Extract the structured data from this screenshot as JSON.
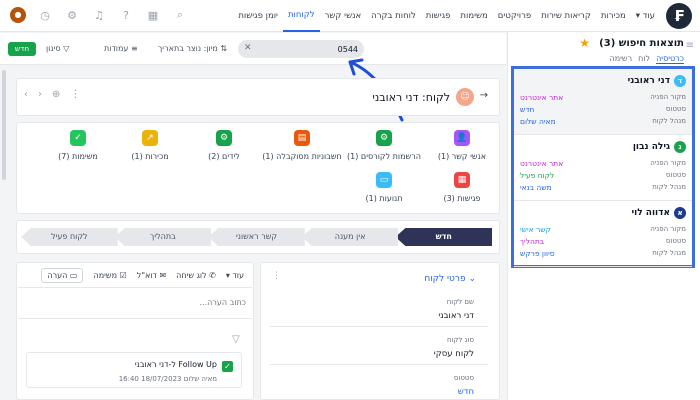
{
  "topbar": {
    "logo": "₣",
    "nav": [
      "יומן פגישות",
      "לקוחות",
      "אנשי קשר",
      "לוחות בקרה",
      "פגישות",
      "משימות",
      "פרויקטים",
      "קריאות שירות",
      "מכירות",
      "עוד"
    ],
    "active_index": 1
  },
  "toolbar": {
    "new_label": "חדש",
    "filter_label": "סינון",
    "columns_label": "עמודות",
    "sort_label": "מיון: נוצר בתאריך",
    "search_value": "0544"
  },
  "results": {
    "title": "תוצאות חיפוש (3)",
    "tabs": [
      "כרטיסיה",
      "לוח",
      "רשימה"
    ],
    "active_tab": 0,
    "cards": [
      {
        "name": "דני ראובני",
        "badge": "ד",
        "color": "#38bdf8",
        "rows": [
          {
            "label": "מקור הפניה",
            "value": "אתר אינטרנט",
            "color": "#c026d3"
          },
          {
            "label": "סטטוס",
            "value": "חדש",
            "color": "#2563eb"
          },
          {
            "label": "מנהל לקוח",
            "value": "מאיה שלום",
            "color": "#2563eb"
          }
        ]
      },
      {
        "name": "גילה נבון",
        "badge": "ג",
        "color": "#16a34a",
        "rows": [
          {
            "label": "מקור הפניה",
            "value": "אתר אינטרנט",
            "color": "#c026d3"
          },
          {
            "label": "סטטוס",
            "value": "לקוח פעיל",
            "color": "#16a34a"
          },
          {
            "label": "מנהל לקוח",
            "value": "משה בנאי",
            "color": "#2563eb"
          }
        ]
      },
      {
        "name": "אדווה לוי",
        "badge": "א",
        "color": "#1e3a8a",
        "rows": [
          {
            "label": "מקור הפניה",
            "value": "קשר אישי",
            "color": "#0ea5e9"
          },
          {
            "label": "סטטוס",
            "value": "בתהליך",
            "color": "#c026d3"
          },
          {
            "label": "מנהל לקוח",
            "value": "סיוון פרקש",
            "color": "#2563eb"
          }
        ]
      }
    ]
  },
  "lead": {
    "title": "לקוח: דני ראובני",
    "avatar": "👤",
    "tiles_row1": [
      {
        "label": "אנשי קשר (1)",
        "color": "#a855f7",
        "icon": "👤"
      },
      {
        "label": "הרשמות לקורסים (1)",
        "color": "#16a34a",
        "icon": "⚙"
      },
      {
        "label": "חשבוניות מסוקבלה (1)",
        "color": "#ea580c",
        "icon": "▤"
      },
      {
        "label": "לידים (2)",
        "color": "#16a34a",
        "icon": "⚙"
      },
      {
        "label": "מכירות (1)",
        "color": "#eab308",
        "icon": "↗"
      },
      {
        "label": "משימות (7)",
        "color": "#22c55e",
        "icon": "✓"
      }
    ],
    "tiles_row2": [
      {
        "label": "פגישות (3)",
        "color": "#ef4444",
        "icon": "▦"
      },
      {
        "label": "תנועות (1)",
        "color": "#38bdf8",
        "icon": "▭"
      }
    ],
    "stages": [
      "חדש",
      "אין מענה",
      "קשר ראשוני",
      "בתהליך",
      "לקוח פעיל"
    ],
    "current_stage": 0
  },
  "details": {
    "section_title": "פרטי לקוח",
    "fields": [
      {
        "label": "שם לקוח",
        "value": "דני ראובני"
      },
      {
        "label": "סוג לקוח",
        "value": "לקוח עסקי"
      },
      {
        "label": "סטטוס",
        "value": "חדש"
      }
    ]
  },
  "activity": {
    "tabs": [
      "הערה",
      "משימה",
      "דוא\"ל",
      "לוג שיחה",
      "עוד"
    ],
    "note_placeholder": "כתוב הערה...",
    "followup_title": "Follow Up ל-דני ראובני",
    "followup_meta": "מאיה שלום  18/07/2023 16:40"
  }
}
